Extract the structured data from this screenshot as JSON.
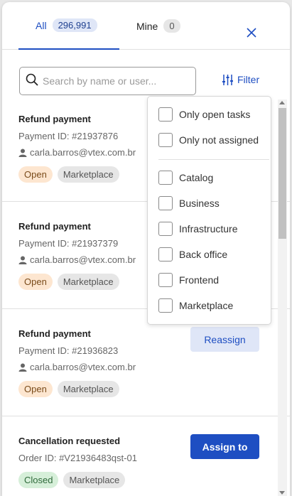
{
  "tabs": {
    "all": {
      "label": "All",
      "count": "296,991"
    },
    "mine": {
      "label": "Mine",
      "count": "0"
    }
  },
  "search": {
    "placeholder": "Search by name or user..."
  },
  "filter": {
    "label": "Filter"
  },
  "filter_menu": {
    "status": [
      "Only open tasks",
      "Only not assigned"
    ],
    "teams": [
      "Catalog",
      "Business",
      "Infrastructure",
      "Back office",
      "Frontend",
      "Marketplace"
    ]
  },
  "tasks": [
    {
      "title": "Refund payment",
      "id": "Payment ID: #21937876",
      "user": "carla.barros@vtex.com.br",
      "status": "Open",
      "team": "Marketplace"
    },
    {
      "title": "Refund payment",
      "id": "Payment ID: #21937379",
      "user": "carla.barros@vtex.com.br",
      "status": "Open",
      "team": "Marketplace"
    },
    {
      "title": "Refund payment",
      "id": "Payment ID: #21936823",
      "user": "carla.barros@vtex.com.br",
      "status": "Open",
      "team": "Marketplace",
      "action": "Reassign"
    },
    {
      "title": "Cancellation requested",
      "id": "Order ID: #V21936483qst-01",
      "status": "Closed",
      "team": "Marketplace",
      "action": "Assign to"
    }
  ],
  "colors": {
    "accent": "#1e4ec2",
    "open": "#fde6d0",
    "closed": "#d6efd9"
  }
}
